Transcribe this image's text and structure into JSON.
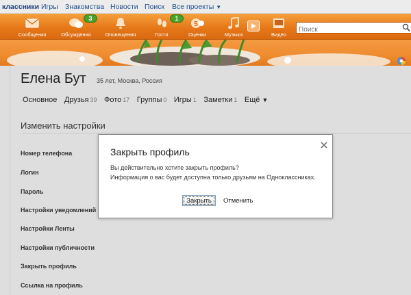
{
  "topnav": {
    "brand": "классники",
    "links": [
      "Игры",
      "Знакомства",
      "Новости",
      "Поиск"
    ],
    "all_projects": "Все проекты"
  },
  "toolbar": {
    "items": [
      {
        "label": "Сообщения",
        "icon": "envelope-icon"
      },
      {
        "label": "Обсуждения",
        "icon": "chat-bubbles-icon",
        "badge": "3"
      },
      {
        "label": "Оповещения",
        "icon": "bell-icon"
      },
      {
        "label": "Гости",
        "icon": "footprints-icon",
        "badge": "1"
      },
      {
        "label": "Оценки",
        "icon": "rating-five-icon"
      },
      {
        "label": "Музыка",
        "icon": "music-note-icon"
      },
      {
        "label": "Видео",
        "icon": "video-icon"
      }
    ],
    "search_placeholder": "Поиск"
  },
  "profile": {
    "name": "Елена Бут",
    "meta": "35 лет, Москва, Россия",
    "tabs": [
      {
        "label": "Основное",
        "count": ""
      },
      {
        "label": "Друзья",
        "count": "39"
      },
      {
        "label": "Фото",
        "count": "17"
      },
      {
        "label": "Группы",
        "count": "0"
      },
      {
        "label": "Игры",
        "count": "1"
      },
      {
        "label": "Заметки",
        "count": "1"
      },
      {
        "label": "Ещё",
        "count": ""
      }
    ]
  },
  "settings": {
    "title": "Изменить настройки",
    "items": [
      "Номер телефона",
      "Логин",
      "Пароль",
      "Настройки уведомлений",
      "Настройки Ленты",
      "Настройки публичности",
      "Закрыть профиль",
      "Ссылка на профиль"
    ]
  },
  "dialog": {
    "title": "Закрыть профиль",
    "line1": "Вы действительно хотите закрыть профиль?",
    "line2": "Информация о вас будет доступна только друзьям на Одноклассниках.",
    "confirm": "Закрыть",
    "cancel": "Отменить"
  },
  "colors": {
    "toolbar": "#e6781a",
    "link": "#1f4f8b",
    "badge": "#49a02a"
  }
}
